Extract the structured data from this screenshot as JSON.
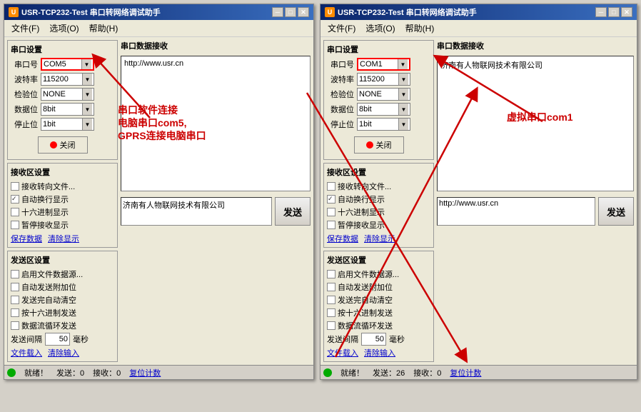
{
  "windows": [
    {
      "id": "left",
      "title": "USR-TCP232-Test 串口转网络调试助手",
      "menu": [
        "文件(F)",
        "选项(O)",
        "帮助(H)"
      ],
      "serial_settings": {
        "title": "串口设置",
        "port_label": "串口号",
        "port_value": "COM5",
        "baud_label": "波特率",
        "baud_value": "115200",
        "check_label": "检验位",
        "check_value": "NONE",
        "data_label": "数据位",
        "data_value": "8bit",
        "stop_label": "停止位",
        "stop_value": "1bit",
        "close_btn": "关闭"
      },
      "recv_settings": {
        "title": "接收区设置",
        "options": [
          {
            "label": "接收转向文件...",
            "checked": false
          },
          {
            "label": "自动换行显示",
            "checked": true
          },
          {
            "label": "十六进制显示",
            "checked": false
          },
          {
            "label": "暂停接收显示",
            "checked": false
          }
        ],
        "save_link": "保存数据",
        "clear_link": "清除显示"
      },
      "send_settings": {
        "title": "发送区设置",
        "options": [
          {
            "label": "启用文件数据源...",
            "checked": false
          },
          {
            "label": "自动发送附加位",
            "checked": false
          },
          {
            "label": "发送完自动清空",
            "checked": false
          },
          {
            "label": "按十六进制发送",
            "checked": false
          },
          {
            "label": "数据流循环发送",
            "checked": false
          }
        ],
        "interval_label": "发送间隔",
        "interval_value": "50",
        "interval_unit": "毫秒",
        "file_load": "文件载入",
        "clear_input": "清除输入"
      },
      "recv_area": {
        "content": "http://www.usr.cn"
      },
      "send_area": {
        "content": "济南有人物联网技术有限公司",
        "send_btn": "发送"
      },
      "statusbar": {
        "status": "就绪！",
        "send_count": "发送：0",
        "recv_count": "接收：0",
        "reset": "复位计数"
      }
    },
    {
      "id": "right",
      "title": "USR-TCP232-Test 串口转网络调试助手",
      "menu": [
        "文件(F)",
        "选项(O)",
        "帮助(H)"
      ],
      "serial_settings": {
        "title": "串口设置",
        "port_label": "串口号",
        "port_value": "COM1",
        "baud_label": "波特率",
        "baud_value": "115200",
        "check_label": "检验位",
        "check_value": "NONE",
        "data_label": "数据位",
        "data_value": "8bit",
        "stop_label": "停止位",
        "stop_value": "1bit",
        "close_btn": "关闭"
      },
      "recv_settings": {
        "title": "接收区设置",
        "options": [
          {
            "label": "接收转向文件...",
            "checked": false
          },
          {
            "label": "自动换行显示",
            "checked": true
          },
          {
            "label": "十六进制显示",
            "checked": false
          },
          {
            "label": "暂停接收显示",
            "checked": false
          }
        ],
        "save_link": "保存数据",
        "clear_link": "清除显示"
      },
      "send_settings": {
        "title": "发送区设置",
        "options": [
          {
            "label": "启用文件数据源...",
            "checked": false
          },
          {
            "label": "自动发送附加位",
            "checked": false
          },
          {
            "label": "发送完自动清空",
            "checked": false
          },
          {
            "label": "按十六进制发送",
            "checked": false
          },
          {
            "label": "数据流循环发送",
            "checked": false
          }
        ],
        "interval_label": "发送间隔",
        "interval_value": "50",
        "interval_unit": "毫秒",
        "file_load": "文件载入",
        "clear_input": "清除输入"
      },
      "recv_area": {
        "content": "济南有人物联网技术有限公司"
      },
      "send_area": {
        "content": "http://www.usr.cn",
        "send_btn": "发送"
      },
      "statusbar": {
        "status": "就绪！",
        "send_count": "发送：26",
        "recv_count": "接收：0",
        "reset": "复位计数"
      }
    }
  ],
  "annotations": {
    "left_text_line1": "串口软件连接",
    "left_text_line2": "电脑串口com5,",
    "left_text_line3": "GPRS连接电脑串口",
    "right_text": "虚拟串口com1"
  }
}
